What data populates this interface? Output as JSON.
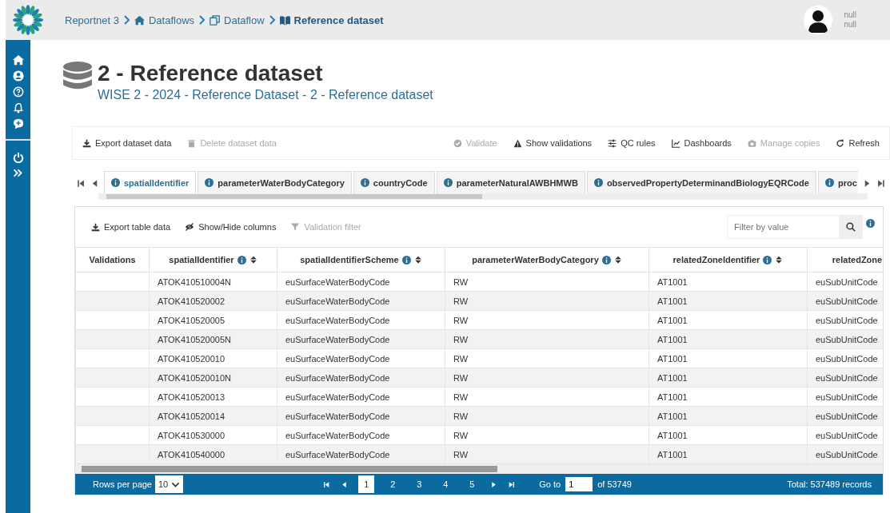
{
  "breadcrumb": [
    {
      "label": "Reportnet 3",
      "current": false
    },
    {
      "label": "Dataflows",
      "current": false
    },
    {
      "label": "Dataflow",
      "current": false
    },
    {
      "label": "Reference dataset",
      "current": true
    }
  ],
  "user": {
    "name": "null",
    "subtitle": "null"
  },
  "title": "2 - Reference dataset",
  "subtitle": "WISE 2 - 2024 - Reference Dataset - 2 - Reference dataset",
  "toolbar_left": [
    {
      "label": "Export dataset data",
      "disabled": false
    },
    {
      "label": "Delete dataset data",
      "disabled": true
    }
  ],
  "toolbar_right": [
    {
      "label": "Validate",
      "disabled": true
    },
    {
      "label": "Show validations",
      "disabled": false
    },
    {
      "label": "QC rules",
      "disabled": false
    },
    {
      "label": "Dashboards",
      "disabled": false
    },
    {
      "label": "Manage copies",
      "disabled": true
    },
    {
      "label": "Refresh",
      "disabled": false
    }
  ],
  "tabs": [
    {
      "label": "spatialIdentifier",
      "selected": true
    },
    {
      "label": "parameterWaterBodyCategory",
      "selected": false
    },
    {
      "label": "countryCode",
      "selected": false
    },
    {
      "label": "parameterNaturalAWBHMWB",
      "selected": false
    },
    {
      "label": "observedPropertyDeterminandBiologyEQRCode",
      "selected": false
    },
    {
      "label": "proc",
      "selected": false
    }
  ],
  "table_toolbar": [
    {
      "label": "Export table data",
      "disabled": false
    },
    {
      "label": "Show/Hide columns",
      "disabled": false
    },
    {
      "label": "Validation filter",
      "disabled": true
    }
  ],
  "filter": {
    "placeholder": "Filter by value"
  },
  "table": {
    "columns": [
      {
        "label": "Validations",
        "info": false
      },
      {
        "label": "spatialIdentifier",
        "info": true
      },
      {
        "label": "spatialIdentifierScheme",
        "info": true
      },
      {
        "label": "parameterWaterBodyCategory",
        "info": true
      },
      {
        "label": "relatedZoneIdentifier",
        "info": true
      },
      {
        "label": "relatedZone",
        "info": false
      }
    ],
    "rows": [
      [
        "",
        "ATOK410510004N",
        "euSurfaceWaterBodyCode",
        "RW",
        "AT1001",
        "euSubUnitCode"
      ],
      [
        "",
        "ATOK410520002",
        "euSurfaceWaterBodyCode",
        "RW",
        "AT1001",
        "euSubUnitCode"
      ],
      [
        "",
        "ATOK410520005",
        "euSurfaceWaterBodyCode",
        "RW",
        "AT1001",
        "euSubUnitCode"
      ],
      [
        "",
        "ATOK410520005N",
        "euSurfaceWaterBodyCode",
        "RW",
        "AT1001",
        "euSubUnitCode"
      ],
      [
        "",
        "ATOK410520010",
        "euSurfaceWaterBodyCode",
        "RW",
        "AT1001",
        "euSubUnitCode"
      ],
      [
        "",
        "ATOK410520010N",
        "euSurfaceWaterBodyCode",
        "RW",
        "AT1001",
        "euSubUnitCode"
      ],
      [
        "",
        "ATOK410520013",
        "euSurfaceWaterBodyCode",
        "RW",
        "AT1001",
        "euSubUnitCode"
      ],
      [
        "",
        "ATOK410520014",
        "euSurfaceWaterBodyCode",
        "RW",
        "AT1001",
        "euSubUnitCode"
      ],
      [
        "",
        "ATOK410530000",
        "euSurfaceWaterBodyCode",
        "RW",
        "AT1001",
        "euSubUnitCode"
      ],
      [
        "",
        "ATOK410540000",
        "euSurfaceWaterBodyCode",
        "RW",
        "AT1001",
        "euSubUnitCode"
      ]
    ]
  },
  "pagination": {
    "rows_label": "Rows per page",
    "rows_value": "10",
    "pages": [
      {
        "label": "1",
        "selected": true
      },
      {
        "label": "2",
        "selected": false
      },
      {
        "label": "3",
        "selected": false
      },
      {
        "label": "4",
        "selected": false
      },
      {
        "label": "5",
        "selected": false
      }
    ],
    "goto_label": "Go to",
    "goto_value": "1",
    "of_label": "of 53749",
    "total": "Total: 537489 records"
  }
}
